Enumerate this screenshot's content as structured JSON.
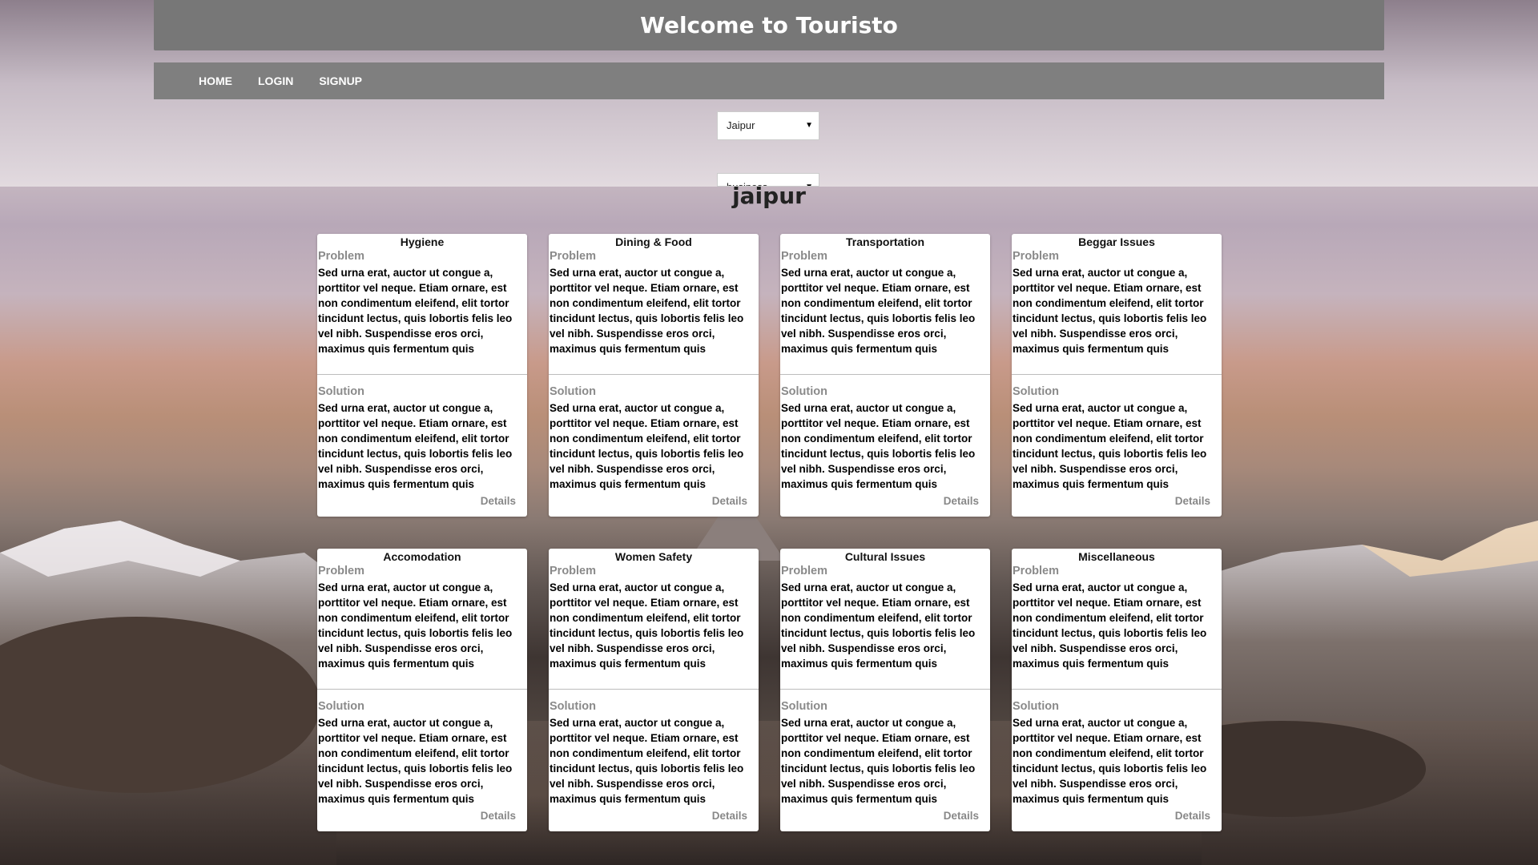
{
  "header": {
    "title": "Welcome to Touristo"
  },
  "nav": {
    "items": [
      "HOME",
      "LOGIN",
      "SIGNUP"
    ]
  },
  "filters": {
    "city_value": "Jaipur",
    "category_value": "business"
  },
  "city_heading": "jaipur",
  "card_labels": {
    "problem": "Problem",
    "solution": "Solution",
    "details": "Details"
  },
  "cards": [
    {
      "title": "Hygiene",
      "problem": "Sed urna erat, auctor ut congue a, porttitor vel neque. Etiam ornare, est non condimentum eleifend, elit tortor tincidunt lectus, quis lobortis felis leo vel nibh. Suspendisse eros orci, maximus quis fermentum quis",
      "solution": "Sed urna erat, auctor ut congue a, porttitor vel neque. Etiam ornare, est non condimentum eleifend, elit tortor tincidunt lectus, quis lobortis felis leo vel nibh. Suspendisse eros orci, maximus quis fermentum quis"
    },
    {
      "title": "Dining & Food",
      "problem": "Sed urna erat, auctor ut congue a, porttitor vel neque. Etiam ornare, est non condimentum eleifend, elit tortor tincidunt lectus, quis lobortis felis leo vel nibh. Suspendisse eros orci, maximus quis fermentum quis",
      "solution": "Sed urna erat, auctor ut congue a, porttitor vel neque. Etiam ornare, est non condimentum eleifend, elit tortor tincidunt lectus, quis lobortis felis leo vel nibh. Suspendisse eros orci, maximus quis fermentum quis"
    },
    {
      "title": "Transportation",
      "problem": "Sed urna erat, auctor ut congue a, porttitor vel neque. Etiam ornare, est non condimentum eleifend, elit tortor tincidunt lectus, quis lobortis felis leo vel nibh. Suspendisse eros orci, maximus quis fermentum quis",
      "solution": "Sed urna erat, auctor ut congue a, porttitor vel neque. Etiam ornare, est non condimentum eleifend, elit tortor tincidunt lectus, quis lobortis felis leo vel nibh. Suspendisse eros orci, maximus quis fermentum quis"
    },
    {
      "title": "Beggar Issues",
      "problem": "Sed urna erat, auctor ut congue a, porttitor vel neque. Etiam ornare, est non condimentum eleifend, elit tortor tincidunt lectus, quis lobortis felis leo vel nibh. Suspendisse eros orci, maximus quis fermentum quis",
      "solution": "Sed urna erat, auctor ut congue a, porttitor vel neque. Etiam ornare, est non condimentum eleifend, elit tortor tincidunt lectus, quis lobortis felis leo vel nibh. Suspendisse eros orci, maximus quis fermentum quis"
    },
    {
      "title": "Accomodation",
      "problem": "Sed urna erat, auctor ut congue a, porttitor vel neque. Etiam ornare, est non condimentum eleifend, elit tortor tincidunt lectus, quis lobortis felis leo vel nibh. Suspendisse eros orci, maximus quis fermentum quis",
      "solution": "Sed urna erat, auctor ut congue a, porttitor vel neque. Etiam ornare, est non condimentum eleifend, elit tortor tincidunt lectus, quis lobortis felis leo vel nibh. Suspendisse eros orci, maximus quis fermentum quis"
    },
    {
      "title": "Women Safety",
      "problem": "Sed urna erat, auctor ut congue a, porttitor vel neque. Etiam ornare, est non condimentum eleifend, elit tortor tincidunt lectus, quis lobortis felis leo vel nibh. Suspendisse eros orci, maximus quis fermentum quis",
      "solution": "Sed urna erat, auctor ut congue a, porttitor vel neque. Etiam ornare, est non condimentum eleifend, elit tortor tincidunt lectus, quis lobortis felis leo vel nibh. Suspendisse eros orci, maximus quis fermentum quis"
    },
    {
      "title": "Cultural Issues",
      "problem": "Sed urna erat, auctor ut congue a, porttitor vel neque. Etiam ornare, est non condimentum eleifend, elit tortor tincidunt lectus, quis lobortis felis leo vel nibh. Suspendisse eros orci, maximus quis fermentum quis",
      "solution": "Sed urna erat, auctor ut congue a, porttitor vel neque. Etiam ornare, est non condimentum eleifend, elit tortor tincidunt lectus, quis lobortis felis leo vel nibh. Suspendisse eros orci, maximus quis fermentum quis"
    },
    {
      "title": "Miscellaneous",
      "problem": "Sed urna erat, auctor ut congue a, porttitor vel neque. Etiam ornare, est non condimentum eleifend, elit tortor tincidunt lectus, quis lobortis felis leo vel nibh. Suspendisse eros orci, maximus quis fermentum quis",
      "solution": "Sed urna erat, auctor ut congue a, porttitor vel neque. Etiam ornare, est non condimentum eleifend, elit tortor tincidunt lectus, quis lobortis felis leo vel nibh. Suspendisse eros orci, maximus quis fermentum quis"
    }
  ]
}
